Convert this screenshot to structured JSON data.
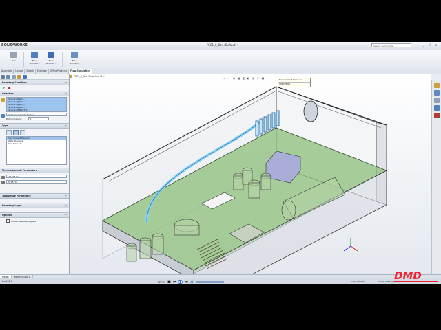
{
  "app": {
    "logo_text": "SOLIDWORKS",
    "document_title": "PEE1_0_Box (Default) *",
    "search_placeholder": "Search Commands",
    "window_controls": [
      "_",
      "❐",
      "×"
    ]
  },
  "ribbon": {
    "buttons": [
      {
        "label": "Run",
        "icon": "run-icon",
        "color": "#9aa4b0"
      },
      {
        "label": "Flow Simulati...",
        "icon": "flow-wizard-icon",
        "color": "#4f7fbf"
      },
      {
        "label": "Flow Simulati...",
        "icon": "flow-sim-icon",
        "color": "#3c6db5"
      }
    ]
  },
  "tabs": [
    "Assembly",
    "Layout",
    "Sketch",
    "Evaluate",
    "Office Products",
    "Flow Simulation"
  ],
  "active_tab": "Flow Simulation",
  "tree": {
    "root": "PEE1_0_Box (Simplified Ch..."
  },
  "property_manager": {
    "title": "Boundary Condition",
    "selection_header": "Selection",
    "faces": [
      "Face<1>@LID1-1",
      "Face<2>@LID1-1",
      "Face<3>@LID1-1",
      "Face<1>@IDE1-1",
      "Face<4>@INLET(1)"
    ],
    "coord_system": "Global Coordinate System",
    "reference_axis_label": "Reference axis:",
    "reference_axis_value": "X",
    "type_header": "Type",
    "types": [
      "Environment Pressure",
      "Static Pressure",
      "Total Pressure"
    ],
    "selected_type": "Environment Pressure",
    "thermo_header": "Thermodynamic Parameters",
    "pressure": "101325 Pa",
    "temperature": "20.05 °C",
    "turbulence_header": "Turbulence Parameters",
    "boundary_layer_header": "Boundary Layer",
    "options_header": "Options",
    "option_checkbox": "Create associated goals"
  },
  "viewport": {
    "tooltip_title": "Environment Pressure",
    "tooltip_value": "101325 Pa",
    "hud_icons": [
      "⌕",
      "⌕",
      "◍",
      "▦",
      "◧",
      "◐",
      "◑",
      "☀",
      "▣"
    ],
    "triad_labels": [
      "X",
      "Y",
      "Z"
    ]
  },
  "bottom_tabs": [
    "Model",
    "Motion Study 1"
  ],
  "status": {
    "left": "Box1_2.0",
    "time": "09:21",
    "right_1": "Fully Defined",
    "right_2": "Editing Assembly"
  },
  "watermark": "DMD",
  "colors": {
    "box_fill": "#8cbf7a",
    "pipe_blue": "#7fd0ff",
    "selection": "#9cc4ef",
    "watermark": "#e22233"
  }
}
